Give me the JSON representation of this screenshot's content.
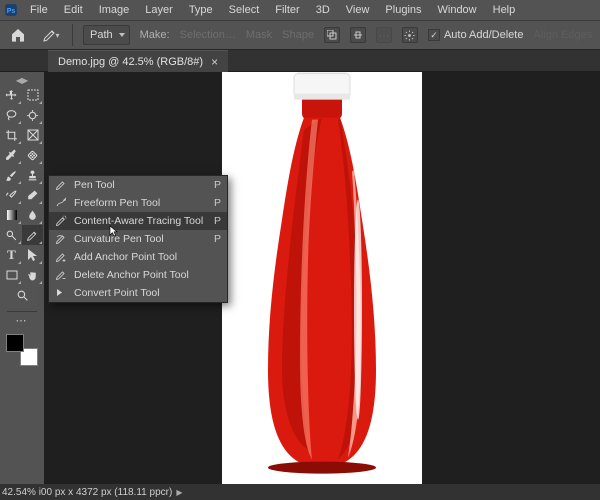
{
  "menu": [
    "File",
    "Edit",
    "Image",
    "Layer",
    "Type",
    "Select",
    "Filter",
    "3D",
    "View",
    "Plugins",
    "Window",
    "Help"
  ],
  "options": {
    "path_mode": "Path",
    "make_label": "Make:",
    "selection_btn": "Selection…",
    "mask_btn": "Mask",
    "shape_btn": "Shape",
    "auto_add_delete": "Auto Add/Delete",
    "align_edges": "Align Edges"
  },
  "tab": {
    "title": "Demo.jpg @ 42.5% (RGB/8#)"
  },
  "flyout": [
    {
      "name": "Pen Tool",
      "shortcut": "P",
      "icon": "pen"
    },
    {
      "name": "Freeform Pen Tool",
      "shortcut": "P",
      "icon": "freeform"
    },
    {
      "name": "Content-Aware Tracing Tool",
      "shortcut": "P",
      "icon": "trace",
      "selected": true
    },
    {
      "name": "Curvature Pen Tool",
      "shortcut": "P",
      "icon": "curve"
    },
    {
      "name": "Add Anchor Point Tool",
      "shortcut": "",
      "icon": "add"
    },
    {
      "name": "Delete Anchor Point Tool",
      "shortcut": "",
      "icon": "del"
    },
    {
      "name": "Convert Point Tool",
      "shortcut": "",
      "icon": "conv"
    }
  ],
  "status": {
    "zoom": "42.54%",
    "dims": "i00 px x 4372 px (118.11 ppcr)"
  },
  "colors": {
    "accent": "#e30613"
  }
}
